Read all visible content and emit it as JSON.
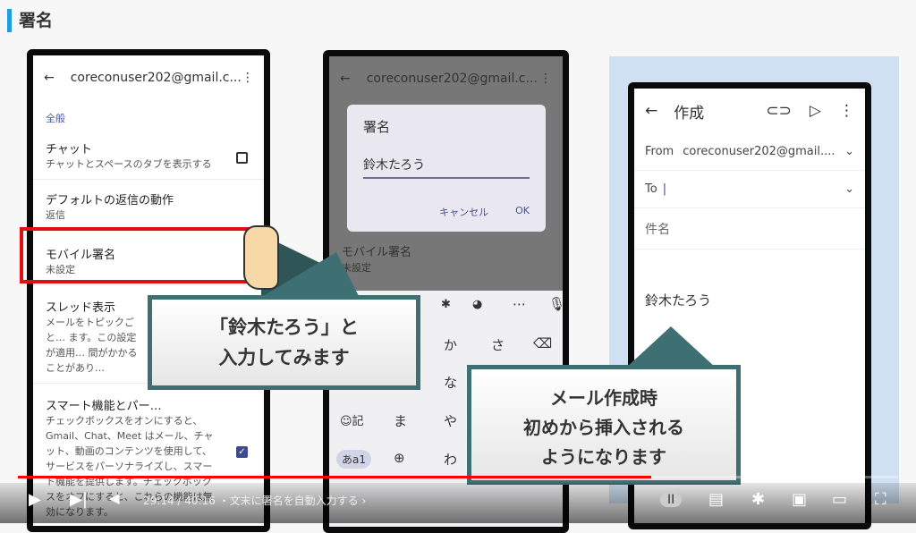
{
  "slide_title": "署名",
  "phone1": {
    "account": "coreconuser202@gmail.c...",
    "section": "全般",
    "rows": [
      {
        "h": "チャット",
        "s": "チャットとスペースのタブを表示する"
      },
      {
        "h": "デフォルトの返信の動作",
        "s": "返信"
      },
      {
        "h": "モバイル署名",
        "s": "未設定"
      },
      {
        "h": "スレッド表示",
        "s": "メールをトピックごと… ます。この設定が適用… 間がかかることがあり…"
      },
      {
        "h": "スマート機能とパー…",
        "s": "チェックボックスをオンにすると、Gmail、Chat、Meet はメール、チャット、動画のコンテンツを使用して、サービスをパーソナライズし、スマート機能を提供します。チェックボックスをオフにすると、これらの機能は無効になります。"
      }
    ]
  },
  "phone2": {
    "account": "coreconuser202@gmail.c...",
    "dialog": {
      "title": "署名",
      "value": "鈴木たろう",
      "cancel": "キャンセル",
      "ok": "OK"
    },
    "bg_row": "モバイル署名",
    "bg_sub": "未設定",
    "keys": [
      "か",
      "さ",
      "な",
      "☺記",
      "ま",
      "や",
      "あa1",
      "わ"
    ]
  },
  "phone3": {
    "title": "作成",
    "from_label": "From",
    "from": "coreconuser202@gmail....",
    "to_label": "To",
    "subject": "件名",
    "body": "鈴木たろう"
  },
  "callout1": [
    "「鈴木たろう」と",
    "入力してみます"
  ],
  "callout2": [
    "メール作成時",
    "初めから挿入される",
    "ようになります"
  ],
  "player": {
    "time": "29:14 / 40:16",
    "chapter": "・文末に署名を自動入力する ›",
    "progress_percent": 72,
    "accent": "#ff0000"
  }
}
